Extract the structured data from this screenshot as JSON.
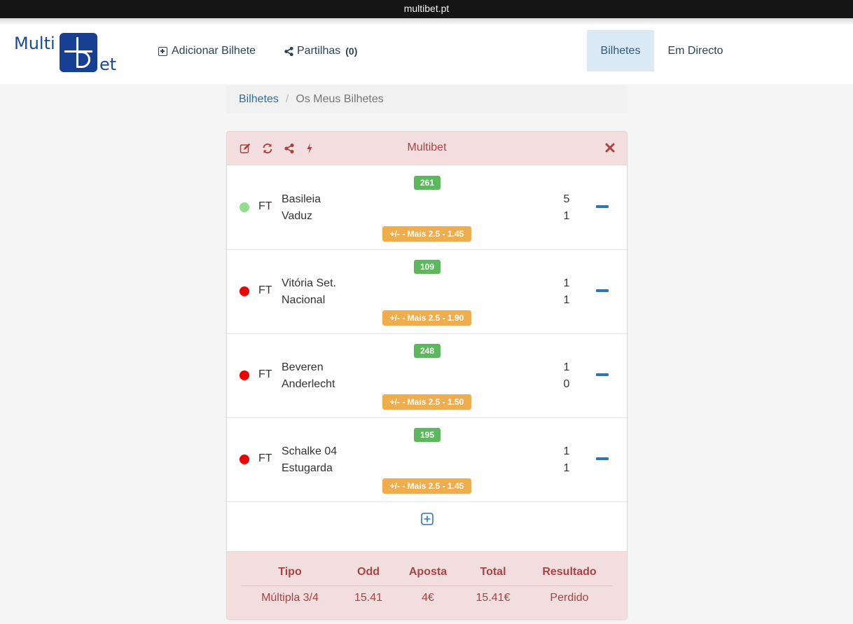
{
  "browser": {
    "url": "multibet.pt"
  },
  "logo": {
    "left_text": "Multi",
    "right_text": "et"
  },
  "nav": {
    "add_ticket": "Adicionar Bilhete",
    "shares": "Partilhas",
    "shares_count": "(0)",
    "tickets": "Bilhetes",
    "live": "Em Directo"
  },
  "breadcrumb": {
    "root": "Bilhetes",
    "current": "Os Meus Bilhetes"
  },
  "panel": {
    "title": "Multibet",
    "icons": [
      "edit-icon",
      "refresh-icon",
      "share-icon",
      "bolt-icon"
    ],
    "colors": {
      "header_bg": "#f2dede",
      "title": "#a94442"
    },
    "matches": [
      {
        "id": "261",
        "status": "FT",
        "status_color": "#8ee08e",
        "home": "Basileia",
        "away": "Vaduz",
        "home_score": "5",
        "away_score": "1",
        "bet": "+/- - Mais 2.5 - 1.45"
      },
      {
        "id": "109",
        "status": "FT",
        "status_color": "#ee0000",
        "home": "Vitória Set.",
        "away": "Nacional",
        "home_score": "1",
        "away_score": "1",
        "bet": "+/- - Mais 2.5 - 1.90"
      },
      {
        "id": "248",
        "status": "FT",
        "status_color": "#ee0000",
        "home": "Beveren",
        "away": "Anderlecht",
        "home_score": "1",
        "away_score": "0",
        "bet": "+/- - Mais 2.5 - 1.50"
      },
      {
        "id": "195",
        "status": "FT",
        "status_color": "#ee0000",
        "home": "Schalke 04",
        "away": "Estugarda",
        "home_score": "1",
        "away_score": "1",
        "bet": "+/- - Mais 2.5 - 1.45"
      }
    ],
    "summary": {
      "headers": [
        "Tipo",
        "Odd",
        "Aposta",
        "Total",
        "Resultado"
      ],
      "values": [
        "Múltipla 3/4",
        "15.41",
        "4€",
        "15.41€",
        "Perdido"
      ]
    }
  }
}
